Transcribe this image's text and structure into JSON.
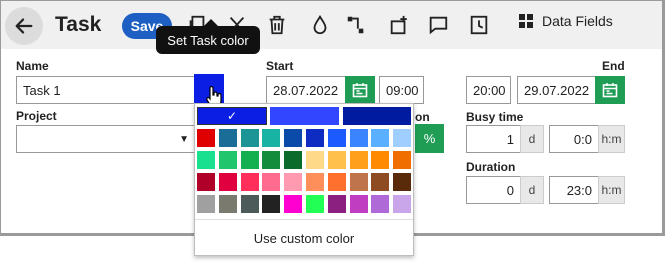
{
  "header": {
    "title": "Task",
    "save_label": "Save",
    "data_fields_label": "Data Fields"
  },
  "tooltip": "Set Task color",
  "form": {
    "name_label": "Name",
    "name_value": "Task 1",
    "project_label": "Project",
    "project_value": "",
    "start_label": "Start",
    "start_date": "28.07.2022",
    "start_time": "09:00",
    "end_label": "End",
    "end_time": "20:00",
    "end_date": "29.07.2022",
    "partial_label": "on",
    "percent_label": "%",
    "busy_label": "Busy time",
    "busy_days": "1",
    "busy_days_unit": "d",
    "busy_hm": "0:0",
    "busy_hm_unit": "h:m",
    "duration_label": "Duration",
    "duration_days": "0",
    "duration_days_unit": "d",
    "duration_hm": "23:0",
    "duration_hm_unit": "h:m"
  },
  "color_picker": {
    "selected_color": "#0a1fe3",
    "checkmark": "✓",
    "recent_colors": [
      "#0a1fe3",
      "#3346ff",
      "#001aa0"
    ],
    "grid_colors": [
      [
        "#e00000",
        "#1a6d97",
        "#1b9595",
        "#19b3a4",
        "#0a4aa8",
        "#0e2bc2",
        "#1a5aff",
        "#3a84ff",
        "#5ab0ff",
        "#a0ceff"
      ],
      [
        "#19e08f",
        "#21c56c",
        "#14b050",
        "#138c3c",
        "#0a6b2a",
        "#ffd98a",
        "#ffc04c",
        "#ff9f1c",
        "#ff8a00",
        "#f06d00"
      ],
      [
        "#b0002a",
        "#e00040",
        "#ff2e5a",
        "#ff6b8e",
        "#ff9ab0",
        "#ff8f5a",
        "#ff6f2e",
        "#c0744c",
        "#8e4a21",
        "#5a2b0a"
      ],
      [
        "#a0a0a0",
        "#7a7a6e",
        "#4d5a5a",
        "#222222",
        "#ff00d0",
        "#22ff55",
        "#8b2080",
        "#c03cc0",
        "#b06ad8",
        "#c9a6ea"
      ]
    ],
    "custom_label": "Use custom color"
  }
}
